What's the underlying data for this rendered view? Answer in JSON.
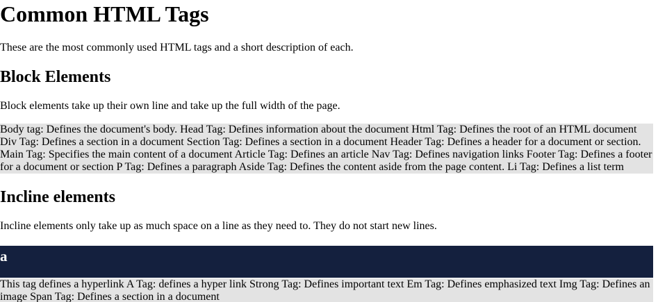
{
  "page": {
    "title": "Common HTML Tags",
    "intro": "These are the most commonly used HTML tags and a short description of each."
  },
  "block_section": {
    "heading": "Block Elements",
    "description": "Block elements take up their own line and take up the full width of the page.",
    "lines": [
      "Body tag: Defines the document's body. Head Tag: Defines information about the document Html Tag: Defines the root of an HTML document",
      "Div Tag: Defines a section in a document Section Tag: Defines a section in a document Header Tag: Defines a header for a document or section.",
      "Main Tag: Specifies the main content of a document Article Tag: Defines an article Nav Tag: Defines navigation links Footer Tag: Defines a footer",
      "for a document or section P Tag: Defines a paragraph Aside Tag: Defines the content aside from the page content. Li Tag: Defines a list term"
    ]
  },
  "inline_section": {
    "heading": "Incline elements",
    "description": "Incline elements only take up as much space on a line as they need to. They do not start new lines.",
    "bar_title": "a",
    "lines": [
      "This tag defines a hyperlink A Tag: defines a hyper link Strong Tag: Defines important text Em Tag: Defines emphasized text Img Tag: Defines an",
      "image Span Tag: Defines a section in a document"
    ]
  },
  "colors": {
    "gray_block": "#e3e3e3",
    "dark_bar": "#14203e"
  }
}
